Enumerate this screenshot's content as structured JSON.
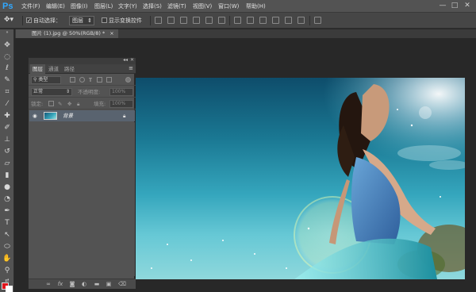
{
  "app": {
    "logo": "Ps"
  },
  "menu": [
    "文件(F)",
    "编辑(E)",
    "图像(I)",
    "图层(L)",
    "文字(Y)",
    "选择(S)",
    "滤镜(T)",
    "视图(V)",
    "窗口(W)",
    "帮助(H)"
  ],
  "window_controls": {
    "minimize": "—",
    "restore": "□",
    "close": "✕"
  },
  "options": {
    "auto_select_label": "自动选择：",
    "auto_select_checked": true,
    "auto_select_target": "图层",
    "show_transform_label": "显示变换控件",
    "show_transform_checked": false
  },
  "document_tab": {
    "title": "图片 (1).jpg @ 50%(RGB/8) *",
    "close": "×"
  },
  "layers_panel": {
    "tabs": [
      "图层",
      "通道",
      "路径"
    ],
    "active_tab": "图层",
    "filter_label": "类型",
    "blend_mode": "正常",
    "opacity_label": "不透明度:",
    "opacity_value": "100%",
    "lock_label": "锁定:",
    "fill_label": "填充:",
    "fill_value": "100%",
    "layers": [
      {
        "name": "背景",
        "visible": true,
        "locked": true
      }
    ],
    "footer_icons": [
      "link-icon",
      "fx-icon",
      "mask-icon",
      "adjustment-icon",
      "group-icon",
      "new-layer-icon",
      "trash-icon"
    ]
  },
  "colors": {
    "foreground": "#e0141b",
    "background": "#ffffff",
    "logo": "#31a8ff"
  }
}
